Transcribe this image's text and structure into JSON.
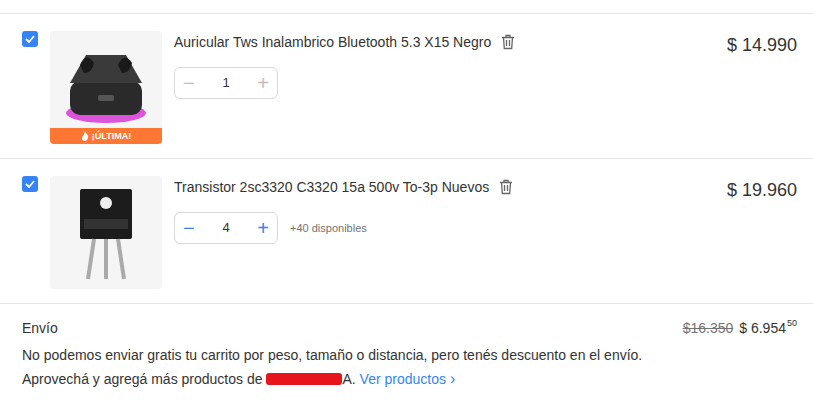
{
  "items": [
    {
      "title": "Auricular Tws Inalambrico Bluetooth 5.3 X15 Negro",
      "checked": true,
      "quantity": "1",
      "price": "$ 14.990",
      "badge": "¡ÚLTIMA!",
      "decrement_enabled": false,
      "increment_enabled": false,
      "decrement_icon": "−",
      "increment_icon": "+",
      "kind": "earbuds"
    },
    {
      "title": "Transistor 2sc3320 C3320 15a 500v To-3p Nuevos",
      "checked": true,
      "quantity": "4",
      "price": "$ 19.960",
      "stock": "+40 disponibles",
      "decrement_enabled": true,
      "increment_enabled": true,
      "decrement_icon": "−",
      "increment_icon": "+",
      "kind": "transistor"
    }
  ],
  "shipping": {
    "label": "Envío",
    "original_price": "$16.350",
    "price": "$ 6.954",
    "price_cents": "50",
    "notice": "No podemos enviar gratis tu carrito por peso, tamaño o distancia, pero tenés descuento en el envío.",
    "promo_prefix": "Aprovechá y agregá más productos de ",
    "promo_suffix": "A.",
    "link": "Ver productos",
    "link_icon": "›"
  }
}
